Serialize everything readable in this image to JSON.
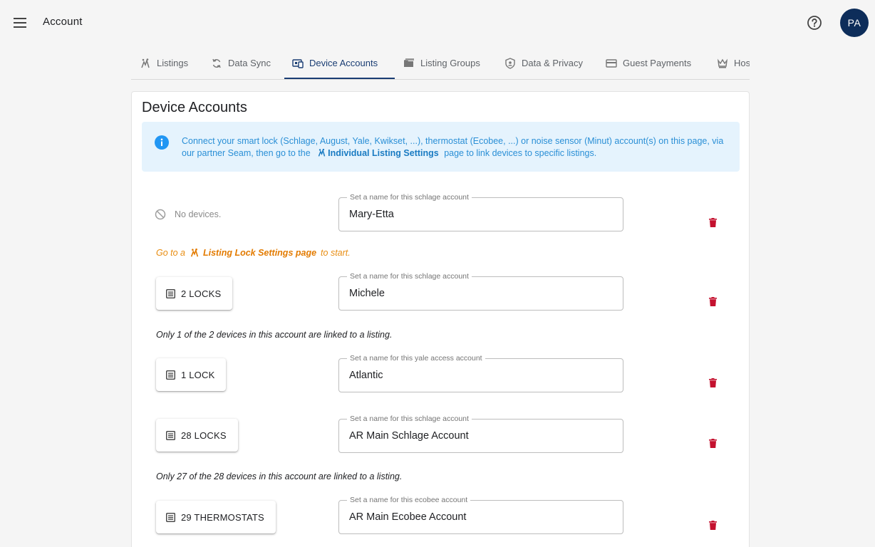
{
  "app": {
    "title": "Account",
    "avatar_initials": "PA"
  },
  "tabs": [
    {
      "label": "Listings",
      "icon": "listings-icon"
    },
    {
      "label": "Data Sync",
      "icon": "sync-icon"
    },
    {
      "label": "Device Accounts",
      "icon": "device-accounts-icon",
      "active": true
    },
    {
      "label": "Listing Groups",
      "icon": "folder-icon"
    },
    {
      "label": "Data & Privacy",
      "icon": "shield-icon"
    },
    {
      "label": "Guest Payments",
      "icon": "credit-card-icon"
    },
    {
      "label": "Hos",
      "icon": "crown-icon"
    }
  ],
  "page": {
    "title": "Device Accounts",
    "info": {
      "text_before": "Connect your smart lock (Schlage, August, Yale, Kwikset, ...), thermostat (Ecobee, ...) or noise sensor (Minut) account(s) on this page, via our partner Seam, then go to the",
      "link_label": "Individual Listing Settings",
      "text_after": "page to link devices to specific listings."
    }
  },
  "accounts": [
    {
      "status": "No devices.",
      "field_label": "Set a name for this schlage account",
      "name": "Mary-Etta",
      "note_prefix": "Go to a",
      "note_link": "Listing Lock Settings page",
      "note_suffix": "to start."
    },
    {
      "button_label": "2 LOCKS",
      "field_label": "Set a name for this schlage account",
      "name": "Michele",
      "note": "Only 1 of the 2 devices in this account are linked to a listing."
    },
    {
      "button_label": "1 LOCK",
      "field_label": "Set a name for this yale access account",
      "name": "Atlantic"
    },
    {
      "button_label": "28 LOCKS",
      "field_label": "Set a name for this schlage account",
      "name": "AR Main Schlage Account",
      "note": "Only 27 of the 28 devices in this account are linked to a listing."
    },
    {
      "button_label": "29 THERMOSTATS",
      "field_label": "Set a name for this ecobee account",
      "name": "AR Main Ecobee Account"
    }
  ],
  "colors": {
    "primary": "#1a3d73",
    "info_bg": "#e5f3fd",
    "info_text": "#2a8fd6",
    "warning": "#e37b00",
    "delete": "#c4112f"
  }
}
